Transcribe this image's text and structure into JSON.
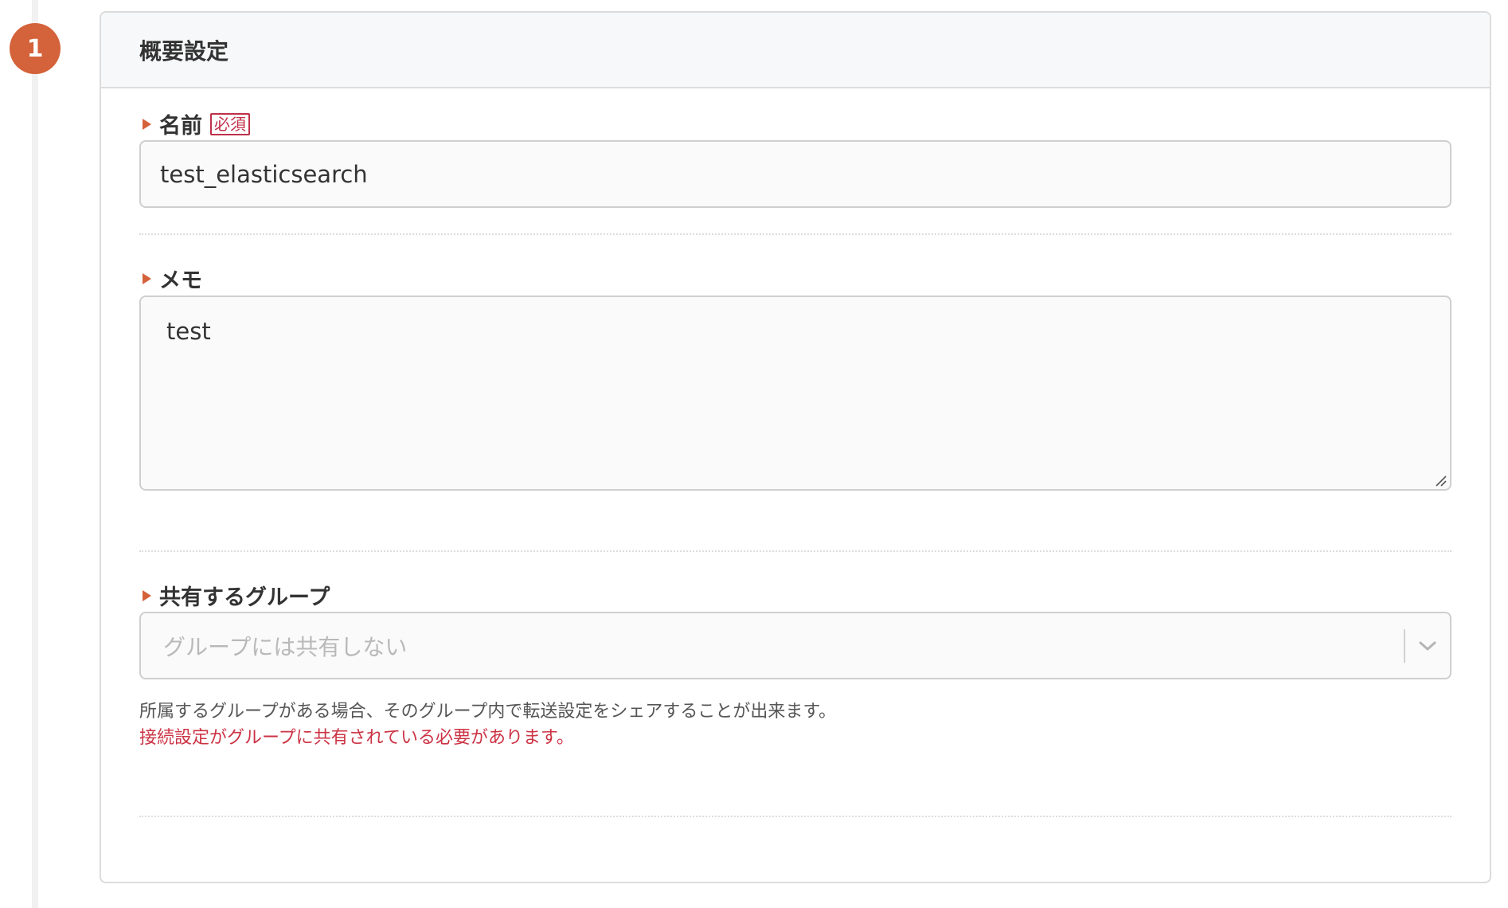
{
  "step": {
    "number": "1"
  },
  "panel": {
    "title": "概要設定"
  },
  "fields": {
    "name": {
      "label": "名前",
      "required_label": "必須",
      "value": "test_elasticsearch"
    },
    "memo": {
      "label": "メモ",
      "value": "test"
    },
    "share_group": {
      "label": "共有するグループ",
      "placeholder": "グループには共有しない",
      "help": "所属するグループがある場合、そのグループ内で転送設定をシェアすることが出来ます。",
      "warning": "接続設定がグループに共有されている必要があります。"
    }
  },
  "icons": {
    "label_marker": "triangle-right-icon",
    "select_toggle": "chevron-down-icon",
    "textarea_resize": "resize-grip-icon"
  },
  "colors": {
    "accent": "#d4623a",
    "required": "#c0304a",
    "warning": "#cc3344"
  }
}
